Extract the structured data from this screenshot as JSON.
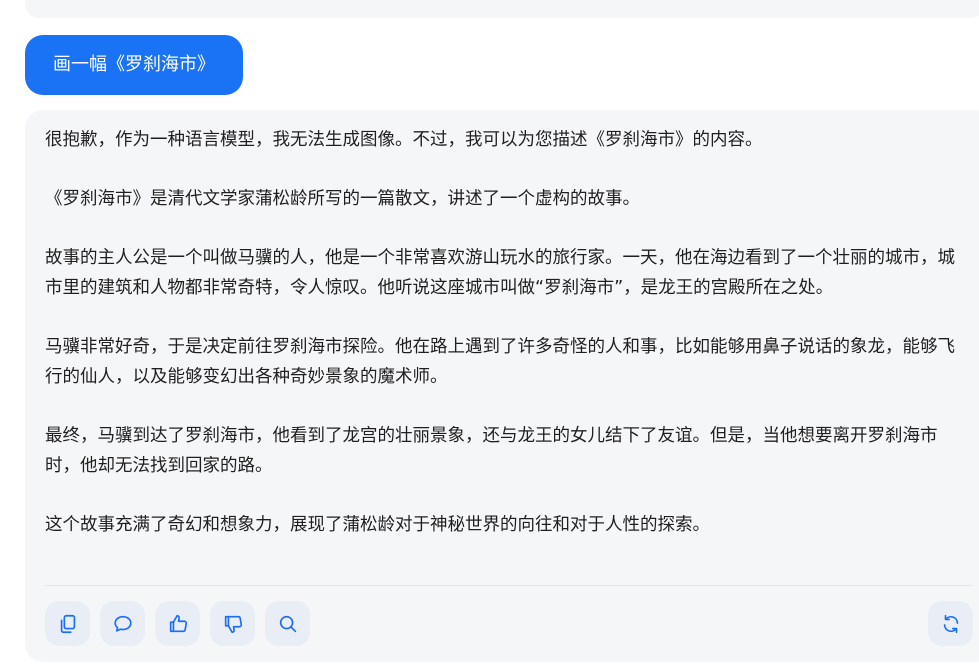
{
  "user_message": {
    "text": "画一幅《罗刹海市》"
  },
  "assistant_message": {
    "paragraphs": [
      "很抱歉，作为一种语言模型，我无法生成图像。不过，我可以为您描述《罗刹海市》的内容。",
      "《罗刹海市》是清代文学家蒲松龄所写的一篇散文，讲述了一个虚构的故事。",
      "故事的主人公是一个叫做马骥的人，他是一个非常喜欢游山玩水的旅行家。一天，他在海边看到了一个壮丽的城市，城市里的建筑和人物都非常奇特，令人惊叹。他听说这座城市叫做“罗刹海市”，是龙王的宫殿所在之处。",
      "马骥非常好奇，于是决定前往罗刹海市探险。他在路上遇到了许多奇怪的人和事，比如能够用鼻子说话的象龙，能够飞行的仙人，以及能够变幻出各种奇妙景象的魔术师。",
      "最终，马骥到达了罗刹海市，他看到了龙宫的壮丽景象，还与龙王的女儿结下了友谊。但是，当他想要离开罗刹海市时，他却无法找到回家的路。",
      "这个故事充满了奇幻和想象力，展现了蒲松龄对于神秘世界的向往和对于人性的探索。"
    ]
  },
  "actions": [
    {
      "icon": "copy-icon"
    },
    {
      "icon": "comment-icon"
    },
    {
      "icon": "thumbs-up-icon"
    },
    {
      "icon": "thumbs-down-icon"
    },
    {
      "icon": "search-icon"
    },
    {
      "icon": "refresh-icon"
    }
  ],
  "colors": {
    "accent": "#1a73f5",
    "card_background": "#f5f6f7",
    "icon_button_background": "#e8edf6",
    "icon_stroke": "#1a6ef5",
    "text": "#1f1f1f"
  }
}
